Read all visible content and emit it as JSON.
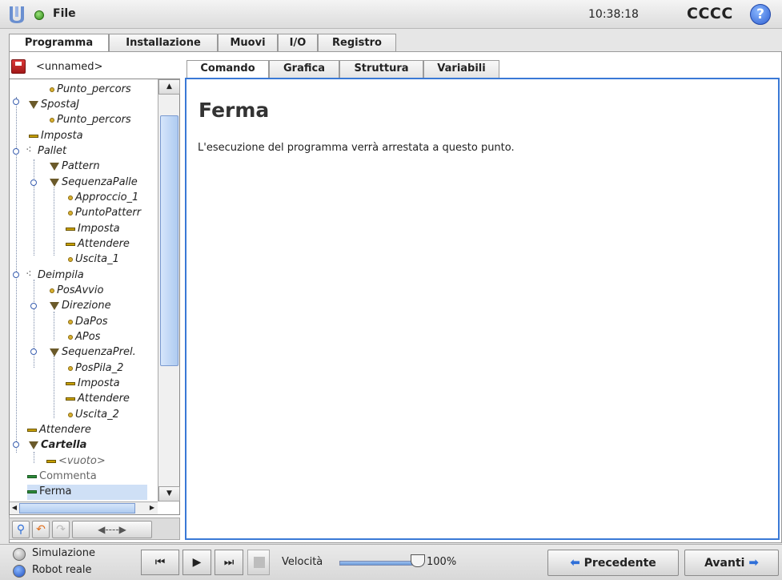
{
  "topbar": {
    "menu_label": "File",
    "time": "10:38:18",
    "robot_name": "CCCC",
    "help": "?"
  },
  "main_tabs": [
    {
      "label": "Programma",
      "active": true
    },
    {
      "label": "Installazione",
      "active": false
    },
    {
      "label": "Muovi",
      "active": false
    },
    {
      "label": "I/O",
      "active": false
    },
    {
      "label": "Registro",
      "active": false
    }
  ],
  "program": {
    "name": "<unnamed>",
    "tree": [
      {
        "label": "Punto_percors",
        "icon": "waypoint-icon"
      },
      {
        "label": "SpostaJ",
        "icon": "move-icon"
      },
      {
        "label": "Punto_percors",
        "icon": "waypoint-icon"
      },
      {
        "label": "Imposta",
        "icon": "set-icon"
      },
      {
        "label": "Pallet",
        "icon": "pallet-icon"
      },
      {
        "label": "Pattern",
        "icon": "move-icon"
      },
      {
        "label": "SequenzaPalle",
        "icon": "move-icon"
      },
      {
        "label": "Approccio_1",
        "icon": "waypoint-icon"
      },
      {
        "label": "PuntoPatterr",
        "icon": "waypoint-icon"
      },
      {
        "label": "Imposta",
        "icon": "set-icon"
      },
      {
        "label": "Attendere",
        "icon": "set-icon"
      },
      {
        "label": "Uscita_1",
        "icon": "waypoint-icon"
      },
      {
        "label": "Deimpila",
        "icon": "pallet-icon"
      },
      {
        "label": "PosAvvio",
        "icon": "waypoint-icon"
      },
      {
        "label": "Direzione",
        "icon": "move-icon"
      },
      {
        "label": "DaPos",
        "icon": "waypoint-icon"
      },
      {
        "label": "APos",
        "icon": "waypoint-icon"
      },
      {
        "label": "SequenzaPrel.",
        "icon": "move-icon"
      },
      {
        "label": "PosPila_2",
        "icon": "waypoint-icon"
      },
      {
        "label": "Imposta",
        "icon": "set-icon"
      },
      {
        "label": "Attendere",
        "icon": "set-icon"
      },
      {
        "label": "Uscita_2",
        "icon": "waypoint-icon"
      },
      {
        "label": "Attendere",
        "icon": "set-icon"
      },
      {
        "label": "Cartella",
        "icon": "folder-icon"
      },
      {
        "label": "<vuoto>",
        "icon": "set-icon"
      },
      {
        "label": "Commenta",
        "icon": "comment-icon"
      },
      {
        "label": "Ferma",
        "icon": "stop-icon",
        "selected": true
      }
    ]
  },
  "sub_tabs": [
    {
      "label": "Comando",
      "active": true
    },
    {
      "label": "Grafica",
      "active": false
    },
    {
      "label": "Struttura",
      "active": false
    },
    {
      "label": "Variabili",
      "active": false
    }
  ],
  "command": {
    "title": "Ferma",
    "description": "L'esecuzione del programma verrà arrestata a questo punto."
  },
  "bottom": {
    "simulation_label": "Simulazione",
    "real_robot_label": "Robot reale",
    "mode_selected": "Robot reale",
    "speed_label": "Velocità",
    "speed_value": "100%",
    "prev_label": "Precedente",
    "next_label": "Avanti"
  },
  "colors": {
    "accent": "#3a79d6",
    "selection": "#cfe0f6",
    "status_ok": "#2f8a1a"
  }
}
